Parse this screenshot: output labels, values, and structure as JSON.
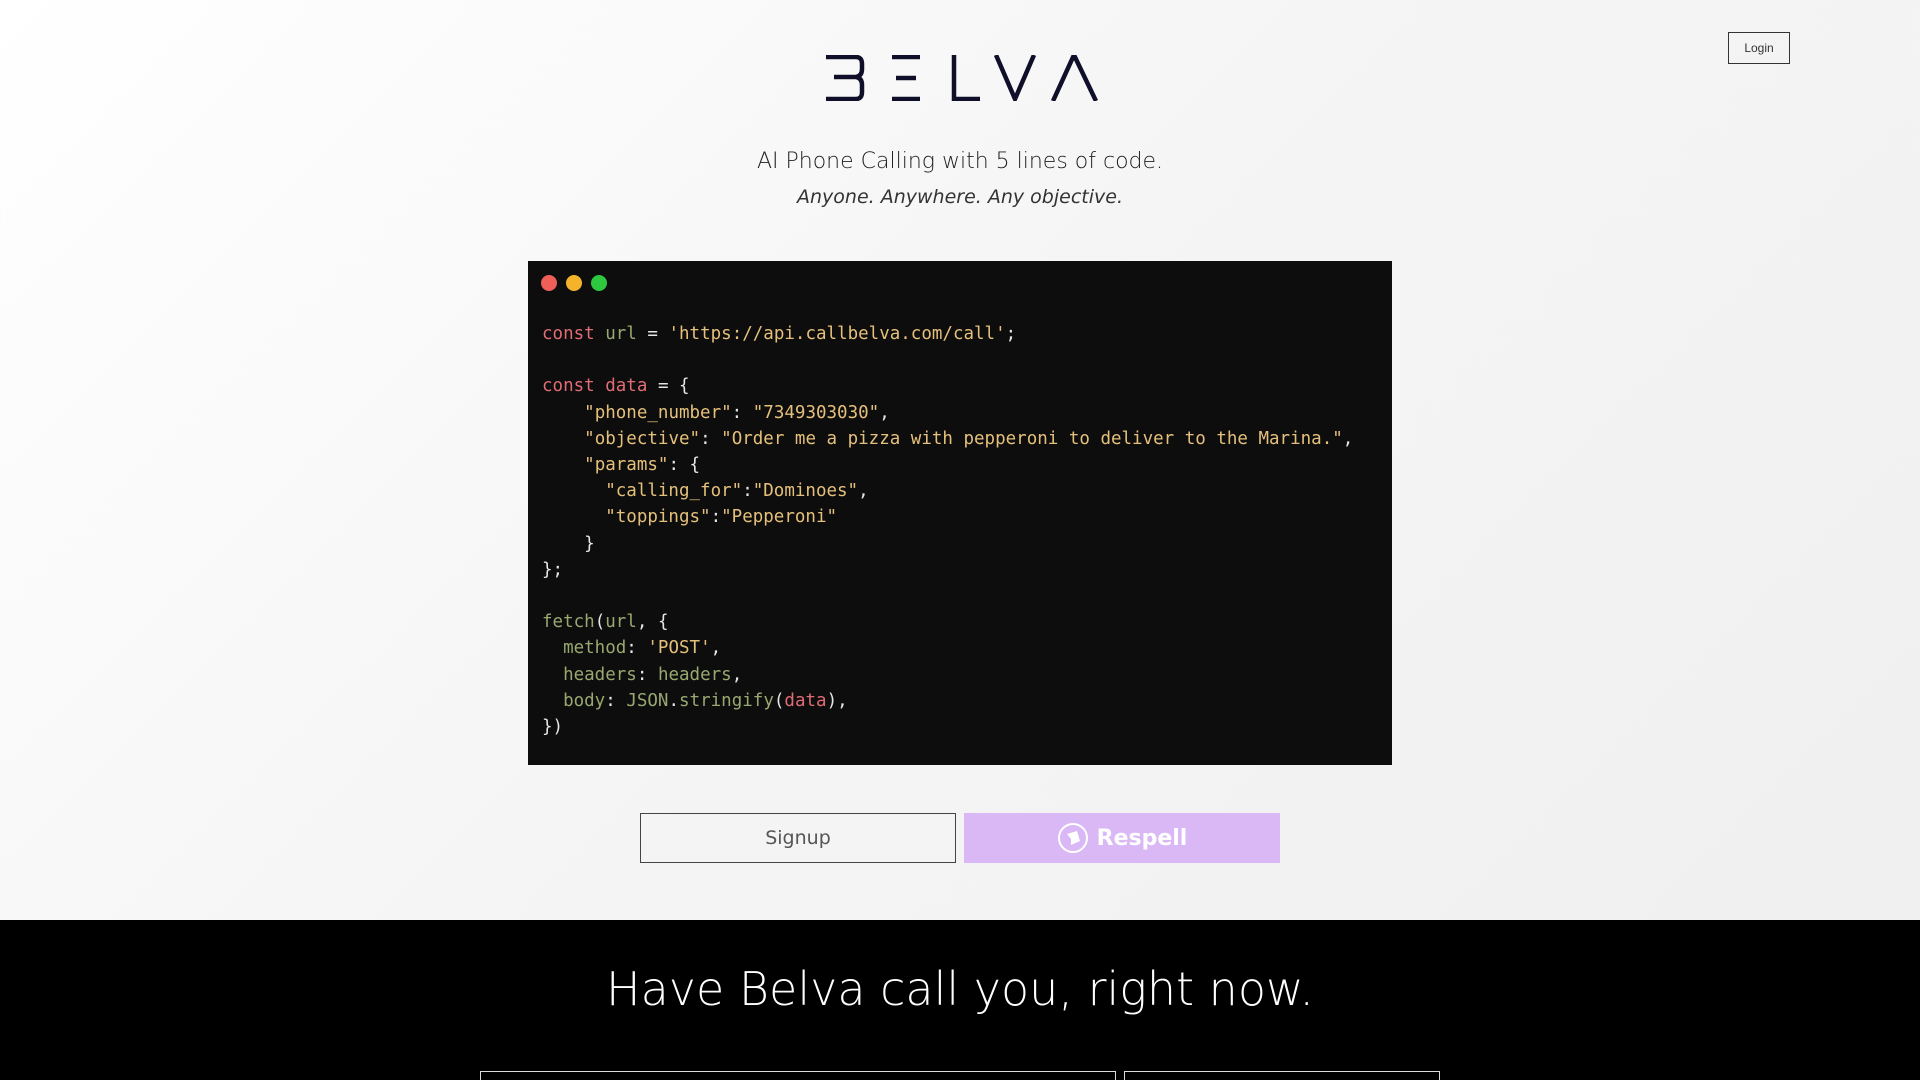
{
  "header": {
    "login_label": "Login"
  },
  "logo": {
    "text": "BELVA",
    "icon": "belva-wordmark"
  },
  "hero": {
    "tagline": "AI Phone Calling with 5 lines of code.",
    "subtagline": "Anyone. Anywhere. Any objective."
  },
  "code_window": {
    "dots": [
      "#ed5f57",
      "#f4b32b",
      "#2ec840"
    ],
    "lines": [
      "const url = 'https://api.callbelva.com/call';",
      "",
      "const data = {",
      "    \"phone_number\": \"7349303030\",",
      "    \"objective\": \"Order me a pizza with pepperoni to deliver to the Marina.\",",
      "    \"params\": {",
      "      \"calling_for\":\"Dominoes\",",
      "      \"toppings\":\"Pepperoni\"",
      "    }",
      "};",
      "",
      "fetch(url, {",
      "  method: 'POST',",
      "  headers: headers,",
      "  body: JSON.stringify(data),",
      "})"
    ]
  },
  "actions": {
    "signup_label": "Signup",
    "respell_label": "Respell",
    "respell_icon": "respell-logo-icon",
    "respell_color": "#d9b8f5"
  },
  "callout": {
    "title": "Have Belva call you, right now."
  },
  "colors": {
    "code_bg": "#0d0d0d",
    "keyword": "#e06c75",
    "string": "#e5c07b",
    "identifier": "#98a870",
    "bottom_bg": "#000000"
  }
}
